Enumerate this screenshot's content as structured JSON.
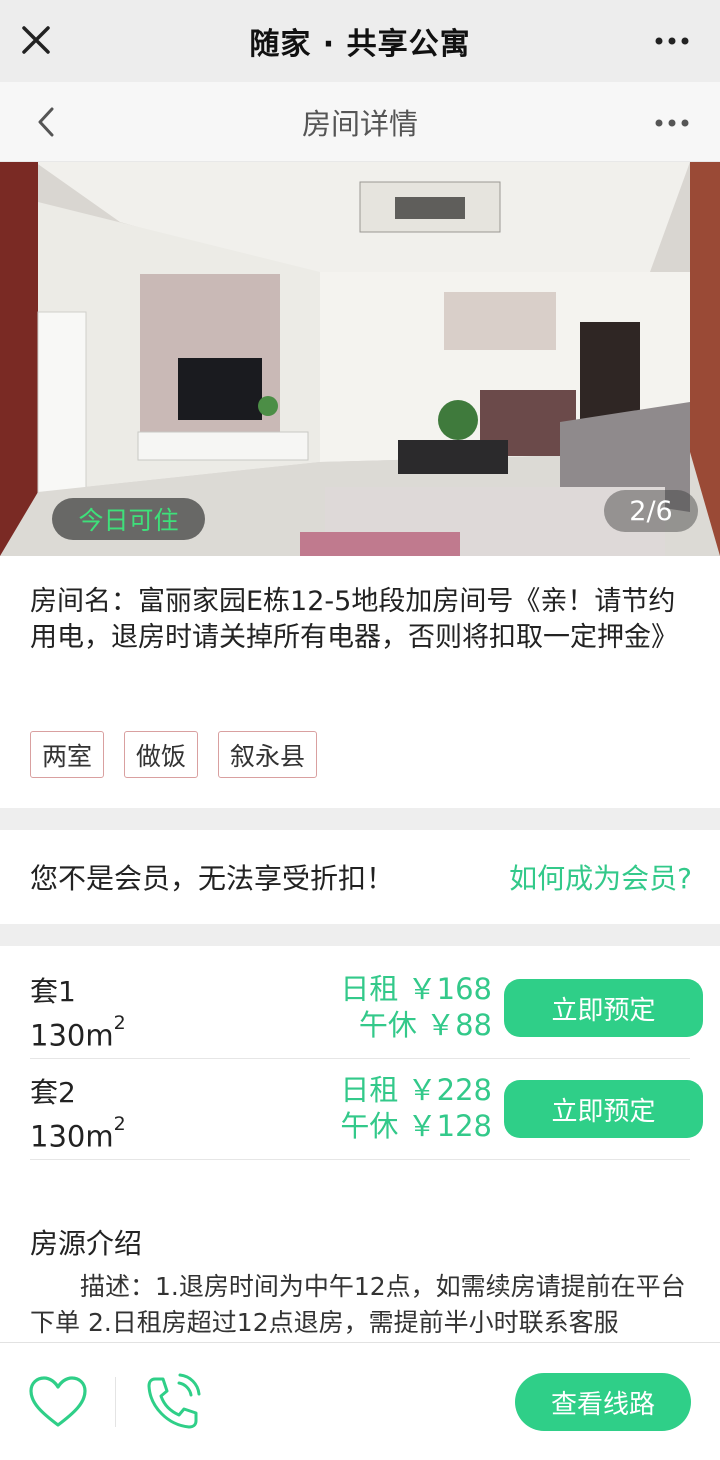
{
  "wechat_bar": {
    "title": "随家 · 共享公寓"
  },
  "nav": {
    "title": "房间详情"
  },
  "gallery": {
    "status_badge": "今日可住",
    "counter": "2/6"
  },
  "room": {
    "name": "房间名：富丽家园E栋12-5地段加房间号《亲！请节约用电，退房时请关掉所有电器，否则将扣取一定押金》",
    "tags": [
      "两室",
      "做饭",
      "叙永县"
    ]
  },
  "membership": {
    "notice": "您不是会员，无法享受折扣！",
    "link": "如何成为会员?"
  },
  "units": [
    {
      "label": "套1",
      "area": "130m",
      "area_sup": "2",
      "daily": "日租 ￥168",
      "nap": "午休 ￥88",
      "book_label": "立即预定"
    },
    {
      "label": "套2",
      "area": "130m",
      "area_sup": "2",
      "daily": "日租 ￥228",
      "nap": "午休 ￥128",
      "book_label": "立即预定"
    }
  ],
  "intro": {
    "title": "房源介绍",
    "text": "描述：1.退房时间为中午12点，如需续房请提前在平台下单 2.日租房超过12点退房，需提前半小时联系客服"
  },
  "bottom_bar": {
    "route_label": "查看线路"
  },
  "colors": {
    "accent": "#2fcf88",
    "badge_green": "#3ee07a",
    "tag_border": "#d9a0a0"
  }
}
